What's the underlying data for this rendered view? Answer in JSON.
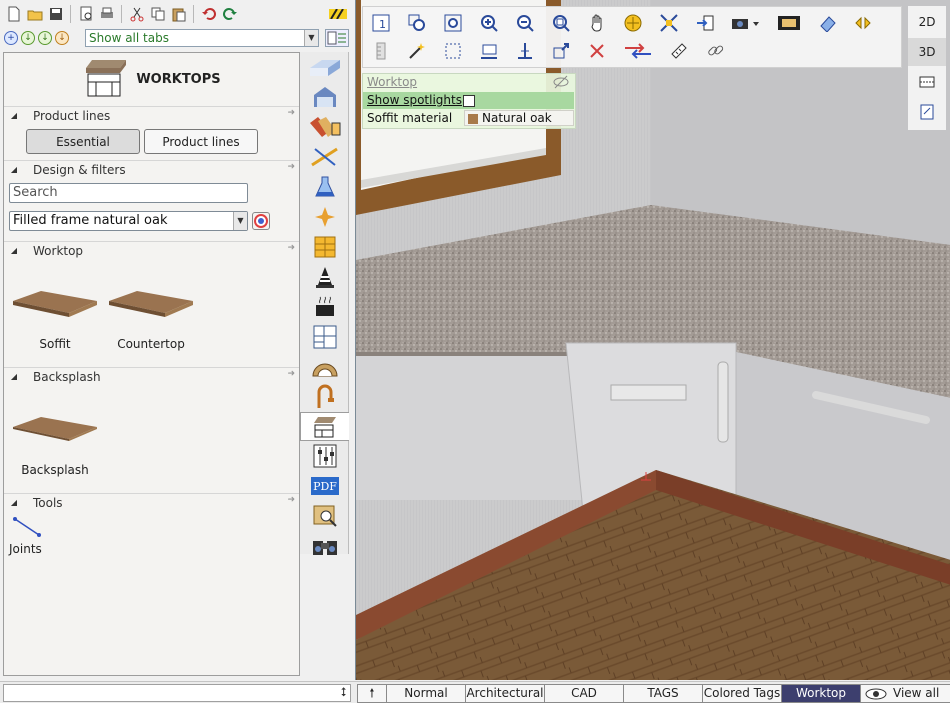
{
  "toolbar": {
    "tab_filter_value": "Show all tabs"
  },
  "catalog": {
    "title": "WORKTOPS",
    "sections": {
      "product_lines": "Product lines",
      "design_filters": "Design & filters",
      "worktop": "Worktop",
      "backsplash": "Backsplash",
      "tools": "Tools"
    },
    "product_line_buttons": [
      "Essential",
      "Product lines"
    ],
    "search_placeholder": "Search",
    "finish_select_value": "Filled frame natural oak",
    "worktop_items": [
      "Soffit",
      "Countertop"
    ],
    "backsplash_items": [
      "Backsplash"
    ],
    "tool_items": [
      "Joints"
    ]
  },
  "view_modes": [
    "2D",
    "3D"
  ],
  "properties": {
    "title": "Worktop",
    "show_spotlights_label": "Show spotlights",
    "show_spotlights_checked": false,
    "soffit_material_label": "Soffit material",
    "soffit_material_value": "Natural oak"
  },
  "status": {
    "view_tabs": [
      "Normal",
      "Architectural",
      "CAD",
      "TAGS",
      "Colored Tags",
      "Worktop",
      "View all"
    ],
    "active_tab": "Worktop"
  },
  "colors": {
    "active_tab_bg": "#3d3f6e",
    "property_highlight": "#a8d8a0",
    "countertop": "#a39b95"
  }
}
